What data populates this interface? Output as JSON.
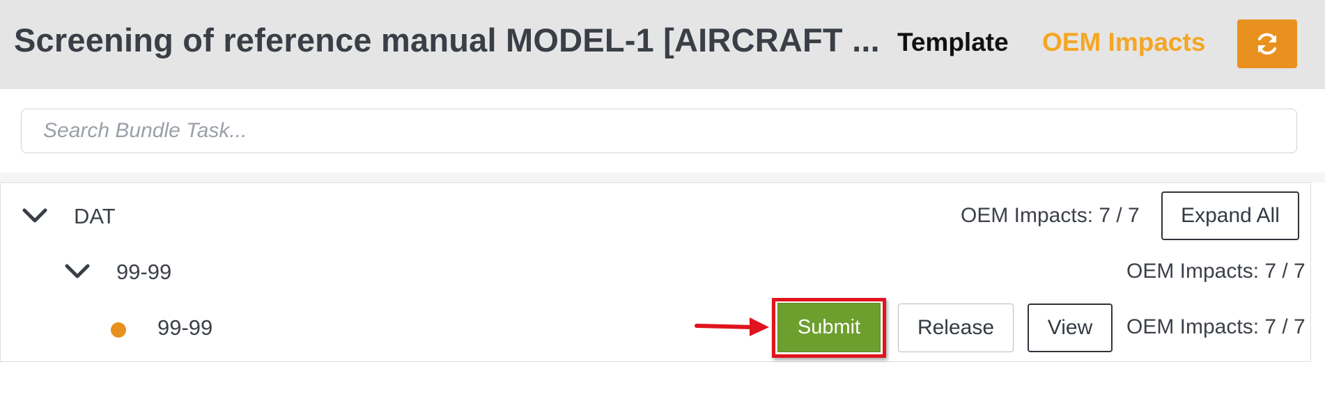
{
  "header": {
    "title": "Screening of reference manual MODEL-1 [AIRCRAFT ...",
    "tabs": [
      {
        "label": "Template",
        "active": false,
        "color": "#111111"
      },
      {
        "label": "OEM Impacts",
        "active": true,
        "color": "#f5a623"
      }
    ],
    "refresh_icon": "refresh-icon",
    "accent_color": "#e8911e"
  },
  "search": {
    "placeholder": "Search Bundle Task...",
    "value": ""
  },
  "tree": {
    "expand_all_label": "Expand All",
    "nodes": [
      {
        "label": "DAT",
        "level": 0,
        "icon": "chevron-down-icon",
        "impacts": "OEM Impacts: 7 / 7"
      },
      {
        "label": "99-99",
        "level": 1,
        "icon": "chevron-down-icon",
        "impacts": "OEM Impacts: 7 / 7"
      },
      {
        "label": "99-99",
        "level": 2,
        "icon": "status-dot-icon",
        "impacts": "OEM Impacts: 7 / 7",
        "actions": {
          "submit": "Submit",
          "release": "Release",
          "view": "View"
        }
      }
    ]
  },
  "annotation": {
    "highlight_color": "#e0141e",
    "submit_color": "#6c9f2e"
  }
}
